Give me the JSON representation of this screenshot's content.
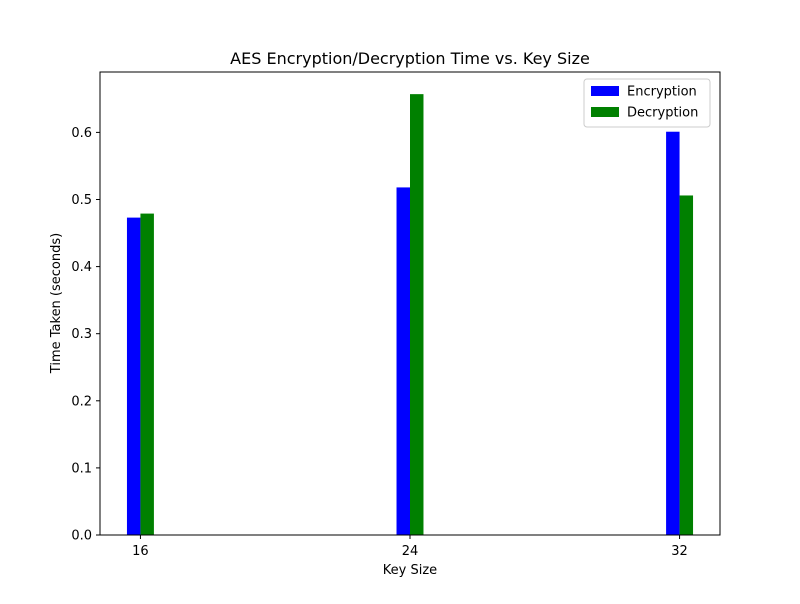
{
  "chart_data": {
    "type": "bar",
    "title": "AES Encryption/Decryption Time vs. Key Size",
    "xlabel": "Key Size",
    "ylabel": "Time Taken (seconds)",
    "x": [
      16,
      24,
      32
    ],
    "xlim": [
      14.8,
      33.2
    ],
    "ylim": [
      0,
      0.69
    ],
    "y_ticks": [
      0.0,
      0.1,
      0.2,
      0.3,
      0.4,
      0.5,
      0.6
    ],
    "y_tick_labels": [
      "0.0",
      "0.1",
      "0.2",
      "0.3",
      "0.4",
      "0.5",
      "0.6"
    ],
    "x_tick_labels": [
      "16",
      "24",
      "32"
    ],
    "bar_width": 0.4,
    "grid": false,
    "legend_position": "top-right",
    "series": [
      {
        "name": "Encryption",
        "color": "#0000ff",
        "values": [
          0.473,
          0.518,
          0.601
        ]
      },
      {
        "name": "Decryption",
        "color": "#008000",
        "values": [
          0.479,
          0.657,
          0.506
        ]
      }
    ]
  }
}
